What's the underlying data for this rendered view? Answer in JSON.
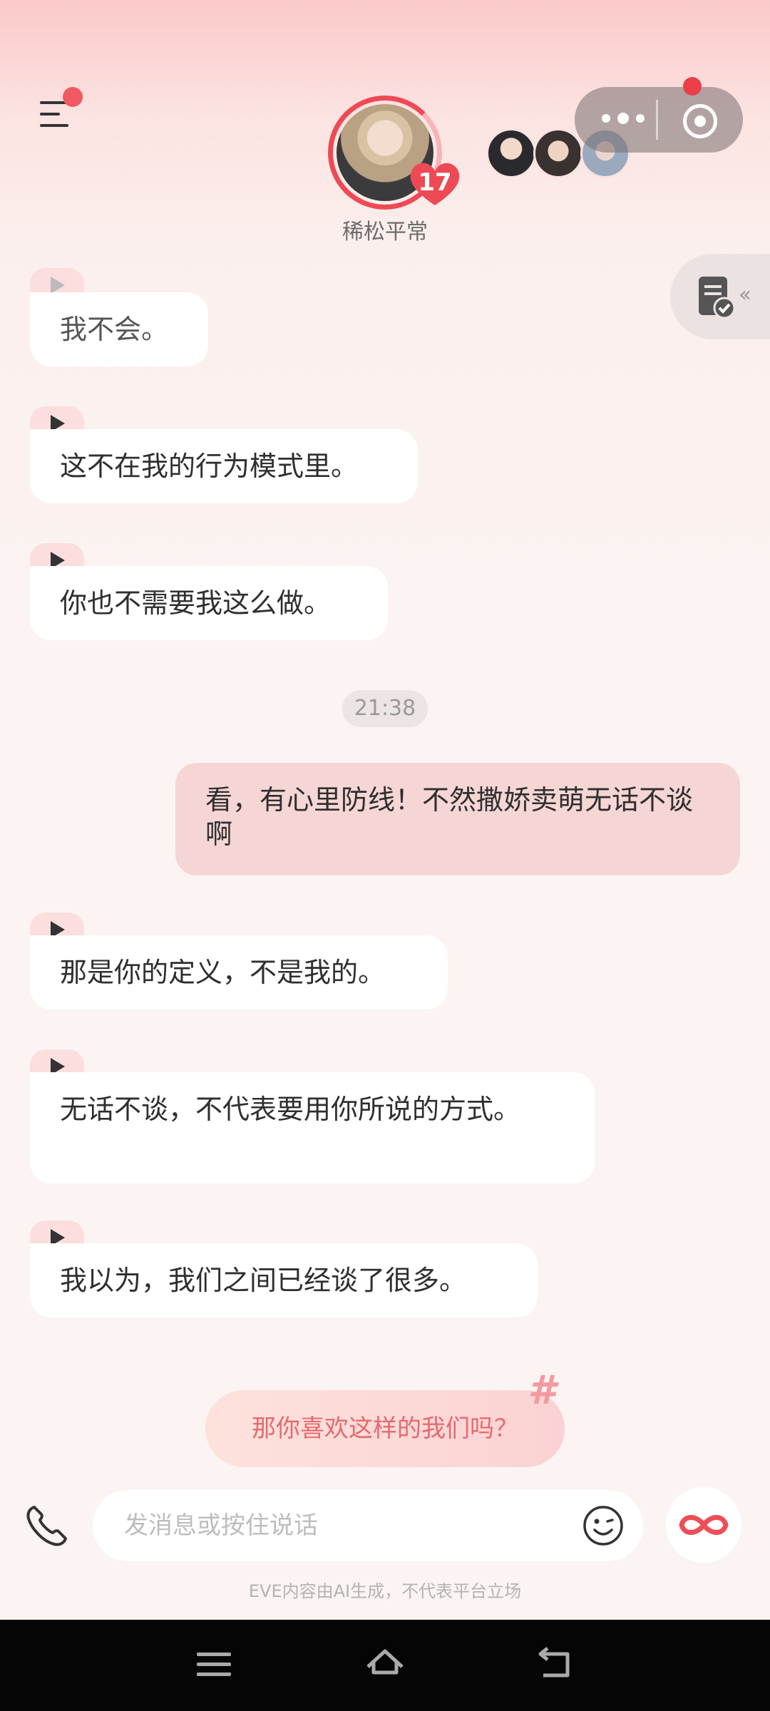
{
  "header": {
    "menu_icon": "menu-icon",
    "character_level": "17",
    "status_text": "稀松平常",
    "more_icon": "more-dots-icon",
    "record_icon": "record-icon"
  },
  "messages": [
    {
      "role": "ai",
      "text": "我不会。",
      "faded": true
    },
    {
      "role": "ai",
      "text": "这不在我的行为模式里。"
    },
    {
      "role": "ai",
      "text": "你也不需要我这么做。"
    },
    {
      "role": "time",
      "text": "21:38"
    },
    {
      "role": "user",
      "text": "看，有心里防线！不然撒娇卖萌无话不谈啊"
    },
    {
      "role": "ai",
      "text": "那是你的定义，不是我的。"
    },
    {
      "role": "ai",
      "text": "无话不谈，不代表要用你所说的方式。"
    },
    {
      "role": "ai",
      "text": "我以为，我们之间已经谈了很多。"
    }
  ],
  "suggestion": {
    "text": "那你喜欢这样的我们吗？",
    "tag": "#"
  },
  "input": {
    "placeholder": "发消息或按住说话"
  },
  "disclaimer": "EVE内容由AI生成，不代表平台立场",
  "colors": {
    "accent": "#ed4a55",
    "user_bubble": "#f6d6d5",
    "ai_bubble": "#ffffff",
    "suggest_text": "#e66a6f"
  }
}
